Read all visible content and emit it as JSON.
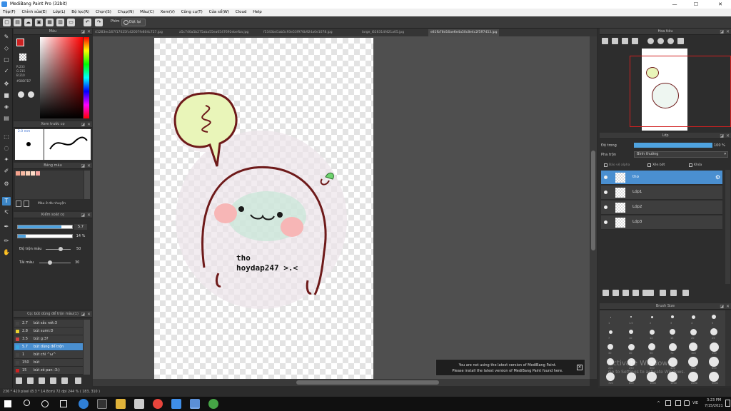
{
  "window": {
    "title": "MediBang Paint Pro (32bit)",
    "min": "—",
    "max": "☐",
    "close": "✕"
  },
  "menu": [
    "Tệp(F)",
    "Chỉnh sửa(E)",
    "Lớp(L)",
    "Bộ lọc(R)",
    "Chọn(S)",
    "Chụp(N)",
    "Màu(C)",
    "Xem(V)",
    "Công cụ(T)",
    "Cửa sổ(W)",
    "Cloud",
    "Help"
  ],
  "toolbar": {
    "snap_label": "Phím",
    "off_label": "Đặt lại"
  },
  "tabs": [
    "41283ec167f17025fc42007fe804c727.jpg",
    "a5c740a5b275aba55ea0547692ebefba.jpg",
    "f5343bd1ab5c93e53f976b924a0e1078.jpg",
    "large_i626314f421a05.jpg",
    "e81fb78d16ae6e4a50c8e4c2f5ff7453.jpg"
  ],
  "color_panel": {
    "title": "Màu",
    "r": "R:233",
    "g": "G:215",
    "b": "B:210",
    "hex": "#D8D7D7",
    "primary": "#cc2222"
  },
  "brush_preview": {
    "title": "Xem trước cọ",
    "size": "2.0 mm"
  },
  "palette": {
    "title": "Bảng màu",
    "mode": "Màu ở đà nhuyện",
    "colors": [
      "#f4a28c",
      "#f7b9a3",
      "#fbd0b7",
      "#fddcc8",
      "#f6a6a0"
    ]
  },
  "brush_control": {
    "title": "Kiểm soát cọ",
    "size_val": "5.7",
    "size_pct": 0.8,
    "opacity_val": "14 %",
    "opacity_pct": 0.14,
    "mix_label": "Độ trộn màu",
    "mix_val": "50",
    "refill_label": "Tải màu",
    "refill_val": "30"
  },
  "brush_list": {
    "title": "Cọ: bút dùng để trộn màu(1)",
    "items": [
      {
        "size": "2.7",
        "name": "bút sắc nét:3",
        "color": "#444444"
      },
      {
        "size": "2.8",
        "name": "bút sumi:D",
        "color": "#e8d030"
      },
      {
        "size": "3.5",
        "name": "bút g:3?",
        "color": "#d04040"
      },
      {
        "size": "5.7",
        "name": "bút dùng để trộn",
        "color": "#3aa8e0",
        "selected": true
      },
      {
        "size": "1",
        "name": "bút chì ^ω^",
        "color": "#444444"
      },
      {
        "size": "150",
        "name": "bút",
        "color": "#444444"
      },
      {
        "size": "15",
        "name": "bút zê pan :3:)",
        "color": "#cc2222"
      }
    ]
  },
  "navigator": {
    "title": "Hoa tiêu"
  },
  "layers": {
    "title": "Lớp",
    "opacity_label": "Độ trong",
    "opacity_val": "100 %",
    "opacity_pct": 1.0,
    "blend_label": "Pha trộn",
    "blend_val": "Bình thường",
    "protect_alpha": "Bảo vệ alpha",
    "clipping": "Xén bớt",
    "lock": "Khóa",
    "items": [
      {
        "name": "tho",
        "selected": true
      },
      {
        "name": "Lớp1"
      },
      {
        "name": "Lớp2"
      },
      {
        "name": "Lớp3"
      }
    ]
  },
  "brush_size": {
    "title": "Brush Size",
    "row1": [
      "1",
      "1.5",
      "2",
      "3",
      "4",
      "5"
    ],
    "row2": [
      "7",
      "10",
      "12",
      "15",
      "20",
      "25"
    ],
    "row3": [
      "30",
      "40",
      "50",
      "70",
      "100",
      "150"
    ],
    "row4": [
      "200",
      "250",
      "300",
      "400",
      "500",
      "600"
    ],
    "row5": [
      "700",
      "800",
      "1000",
      "1500",
      "2000",
      "3000"
    ]
  },
  "artwork": {
    "line1": "tho",
    "line2": "hoydap247 >.<"
  },
  "notice": {
    "line1": "You are not using the latest version of MediBang Paint.",
    "line2": "Please install the latest version of MediBang Paint found here."
  },
  "activation": {
    "line1": "Activate Windows",
    "line2": "Go to Settings to activate Windows."
  },
  "status": "236 * 420 pixel   (8.3 * 14.8cm)   72 dpi   244 %   ( 183, 310 )",
  "clock": {
    "time": "3:23 PM",
    "date": "7/15/2021",
    "lang": "VIE"
  },
  "colors": {
    "accent": "#4a8fd0",
    "panel": "#2d2d2d"
  }
}
